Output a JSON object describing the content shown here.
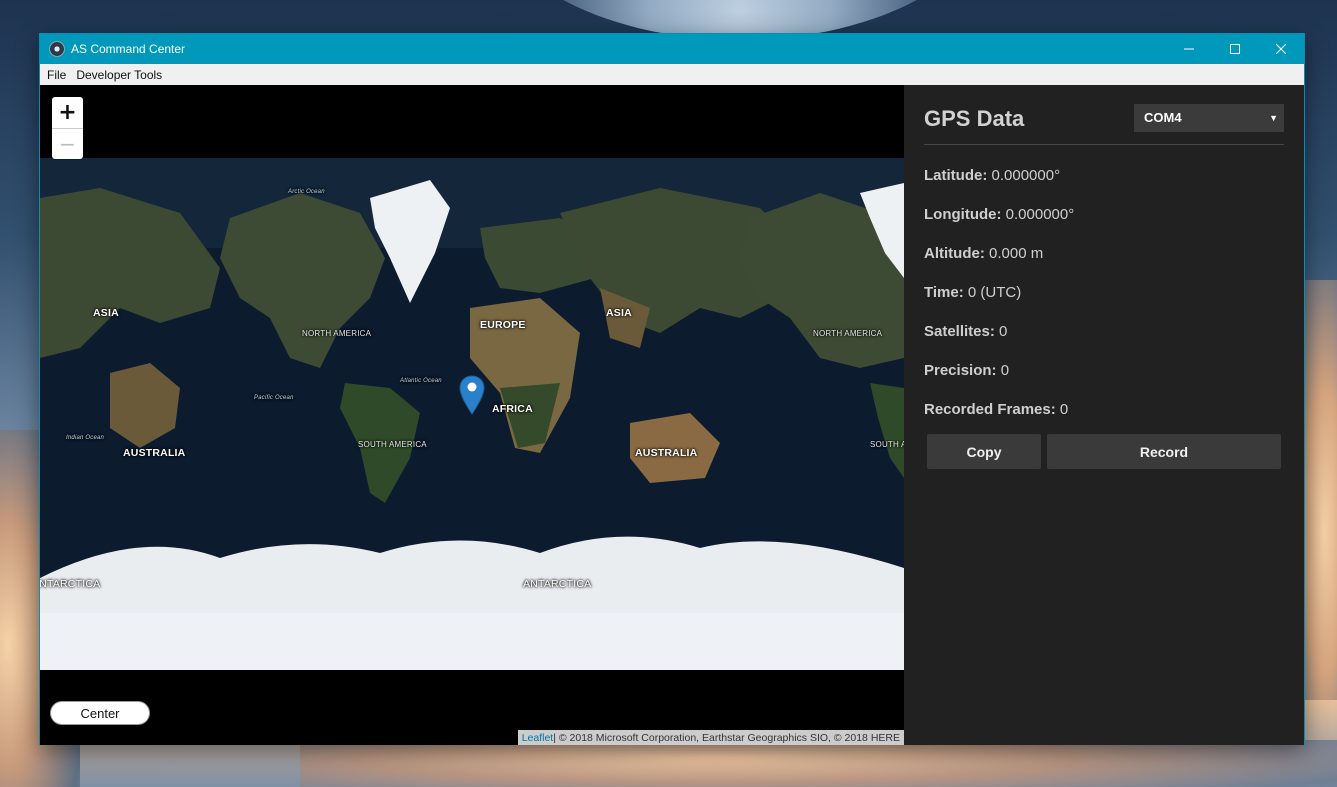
{
  "window": {
    "title": "AS Command Center",
    "controls": {
      "minimize_icon": "minimize-icon",
      "maximize_icon": "maximize-icon",
      "close_icon": "close-icon"
    }
  },
  "menu": [
    "File",
    "Developer Tools"
  ],
  "map": {
    "zoom_in": "+",
    "zoom_out": "−",
    "center_button": "Center",
    "attribution_link": "Leaflet",
    "attribution_text": " | © 2018 Microsoft Corporation, Earthstar Geographics SIO, © 2018 HERE",
    "labels": {
      "asia_left": "ASIA",
      "asia_right": "ASIA",
      "north_america_left": "NORTH AMERICA",
      "north_america_right": "NORTH AMERICA",
      "europe": "EUROPE",
      "africa": "AFRICA",
      "south_america_left": "SOUTH AMERICA",
      "south_america_right": "SOUTH AMERICA",
      "australia_left": "AUSTRALIA",
      "australia_right": "AUSTRALIA",
      "antarctica_left": "ANTARCTICA",
      "antarctica_center": "ANTARCTICA",
      "arctic_ocean": "Arctic Ocean",
      "atlantic_ocean": "Atlantic Ocean",
      "pacific_ocean": "Pacific Ocean",
      "indian_ocean": "Indian Ocean"
    },
    "colors": {
      "ocean": "#0c1b2e",
      "land": "#3e4a34",
      "ice": "#e9edf0",
      "marker": "#2a81cb"
    }
  },
  "panel": {
    "title": "GPS Data",
    "port": "COM4",
    "fields": [
      {
        "label": "Latitude:",
        "value": "0.000000°"
      },
      {
        "label": "Longitude:",
        "value": "0.000000°"
      },
      {
        "label": "Altitude:",
        "value": "0.000 m"
      },
      {
        "label": "Time:",
        "value": "0 (UTC)"
      },
      {
        "label": "Satellites:",
        "value": "0"
      },
      {
        "label": "Precision:",
        "value": "0"
      },
      {
        "label": "Recorded Frames:",
        "value": "0"
      }
    ],
    "buttons": {
      "copy": "Copy",
      "record": "Record"
    }
  }
}
